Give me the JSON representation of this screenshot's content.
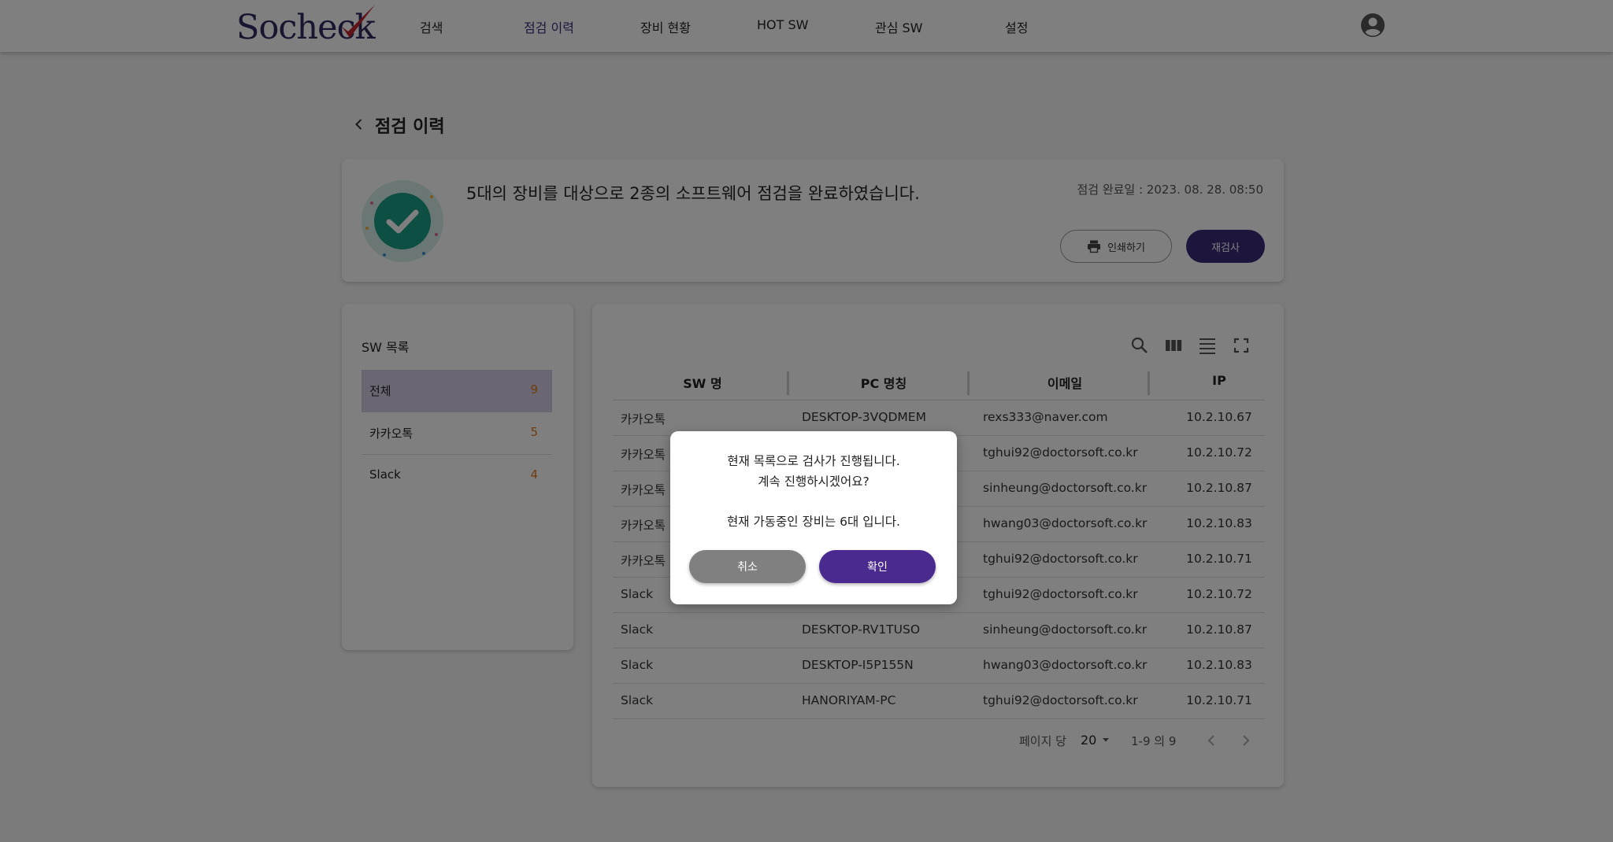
{
  "header": {
    "logo_text": "Socheck",
    "nav": [
      {
        "label": "검색",
        "active": false
      },
      {
        "label": "점검 이력",
        "active": true
      },
      {
        "label": "장비 현황",
        "active": false
      },
      {
        "label": "HOT SW",
        "active": false
      },
      {
        "label": "관심 SW",
        "active": false
      },
      {
        "label": "설정",
        "active": false
      }
    ],
    "user_icon": "account-circle-icon"
  },
  "page": {
    "title": "점검 이력",
    "back_icon": "chevron-left-icon"
  },
  "summary": {
    "message": "5대의 장비를 대상으로 2종의 소프트웨어 점검을 완료하였습니다.",
    "completed_at": "점검 완료일 : 2023. 08. 28. 08:50",
    "print_label": "인쇄하기",
    "recheck_label": "재검사",
    "accent_color": "#3a2a78",
    "check_color": "#1a9e84"
  },
  "sw_list": {
    "title": "SW 목록",
    "items": [
      {
        "name": "전체",
        "count": "9",
        "selected": true
      },
      {
        "name": "카카오톡",
        "count": "5",
        "selected": false
      },
      {
        "name": "Slack",
        "count": "4",
        "selected": false
      }
    ],
    "count_color": "#e0761c"
  },
  "table": {
    "toolbar_icons": [
      "search-icon",
      "columns-icon",
      "density-icon",
      "fullscreen-icon"
    ],
    "columns": [
      "SW 명",
      "PC 명칭",
      "이메일",
      "IP"
    ],
    "rows": [
      {
        "sw": "카카오톡",
        "pc": "DESKTOP-3VQDMEM",
        "email": "rexs333@naver.com",
        "ip": "10.2.10.67"
      },
      {
        "sw": "카카오톡",
        "pc": "",
        "email": "tghui92@doctorsoft.co.kr",
        "ip": "10.2.10.72"
      },
      {
        "sw": "카카오톡",
        "pc": "",
        "email": "sinheung@doctorsoft.co.kr",
        "ip": "10.2.10.87"
      },
      {
        "sw": "카카오톡",
        "pc": "",
        "email": "hwang03@doctorsoft.co.kr",
        "ip": "10.2.10.83"
      },
      {
        "sw": "카카오톡",
        "pc": "",
        "email": "tghui92@doctorsoft.co.kr",
        "ip": "10.2.10.71"
      },
      {
        "sw": "Slack",
        "pc": "",
        "email": "tghui92@doctorsoft.co.kr",
        "ip": "10.2.10.72"
      },
      {
        "sw": "Slack",
        "pc": "DESKTOP-RV1TUSO",
        "email": "sinheung@doctorsoft.co.kr",
        "ip": "10.2.10.87"
      },
      {
        "sw": "Slack",
        "pc": "DESKTOP-I5P155N",
        "email": "hwang03@doctorsoft.co.kr",
        "ip": "10.2.10.83"
      },
      {
        "sw": "Slack",
        "pc": "HANORIYAM-PC",
        "email": "tghui92@doctorsoft.co.kr",
        "ip": "10.2.10.71"
      }
    ],
    "footer": {
      "rows_per_page_label": "페이지 당",
      "rows_per_page_value": "20",
      "range_label": "1-9 의 9"
    }
  },
  "dialog": {
    "line1": "현재 목록으로 검사가 진행됩니다.",
    "line2": "계속 진행하시겠어요?",
    "line3": "현재 가동중인 장비는 6대 입니다.",
    "cancel_label": "취소",
    "ok_label": "확인",
    "ok_color": "#4a2a8e",
    "cancel_color": "#808080"
  }
}
